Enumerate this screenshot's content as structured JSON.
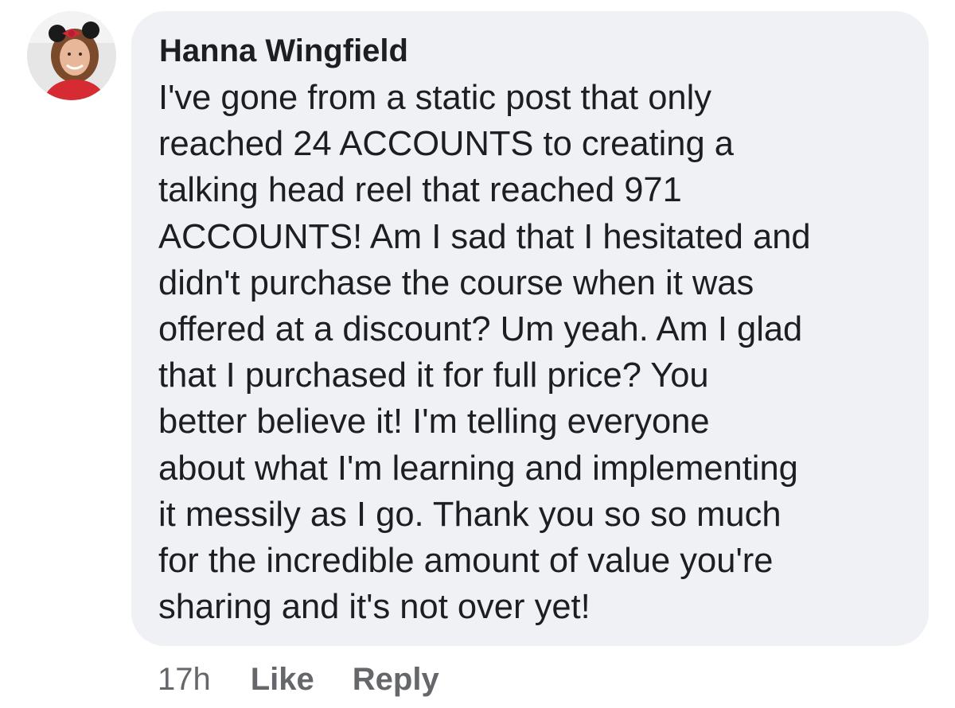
{
  "comment": {
    "author": "Hanna Wingfield",
    "text_lines": [
      "I've gone from a static post that only",
      "reached 24 ACCOUNTS to creating a",
      "talking head reel that reached 971",
      "ACCOUNTS! Am I sad that I hesitated and",
      "didn't purchase the course when it was",
      "offered at a discount? Um yeah. Am I glad",
      "that I purchased it for full price? You",
      "better believe it! I'm telling everyone",
      "about what I'm learning and implementing",
      "it messily as I go. Thank you so so much",
      "for the incredible amount of value you're",
      "sharing and it's not over yet!"
    ],
    "timestamp": "17h",
    "like_label": "Like",
    "reply_label": "Reply"
  },
  "colors": {
    "bubble_background": "#f0f1f4",
    "text": "#1c1e21",
    "meta_text": "#65676b"
  },
  "icons": {
    "avatar": "profile-photo"
  }
}
